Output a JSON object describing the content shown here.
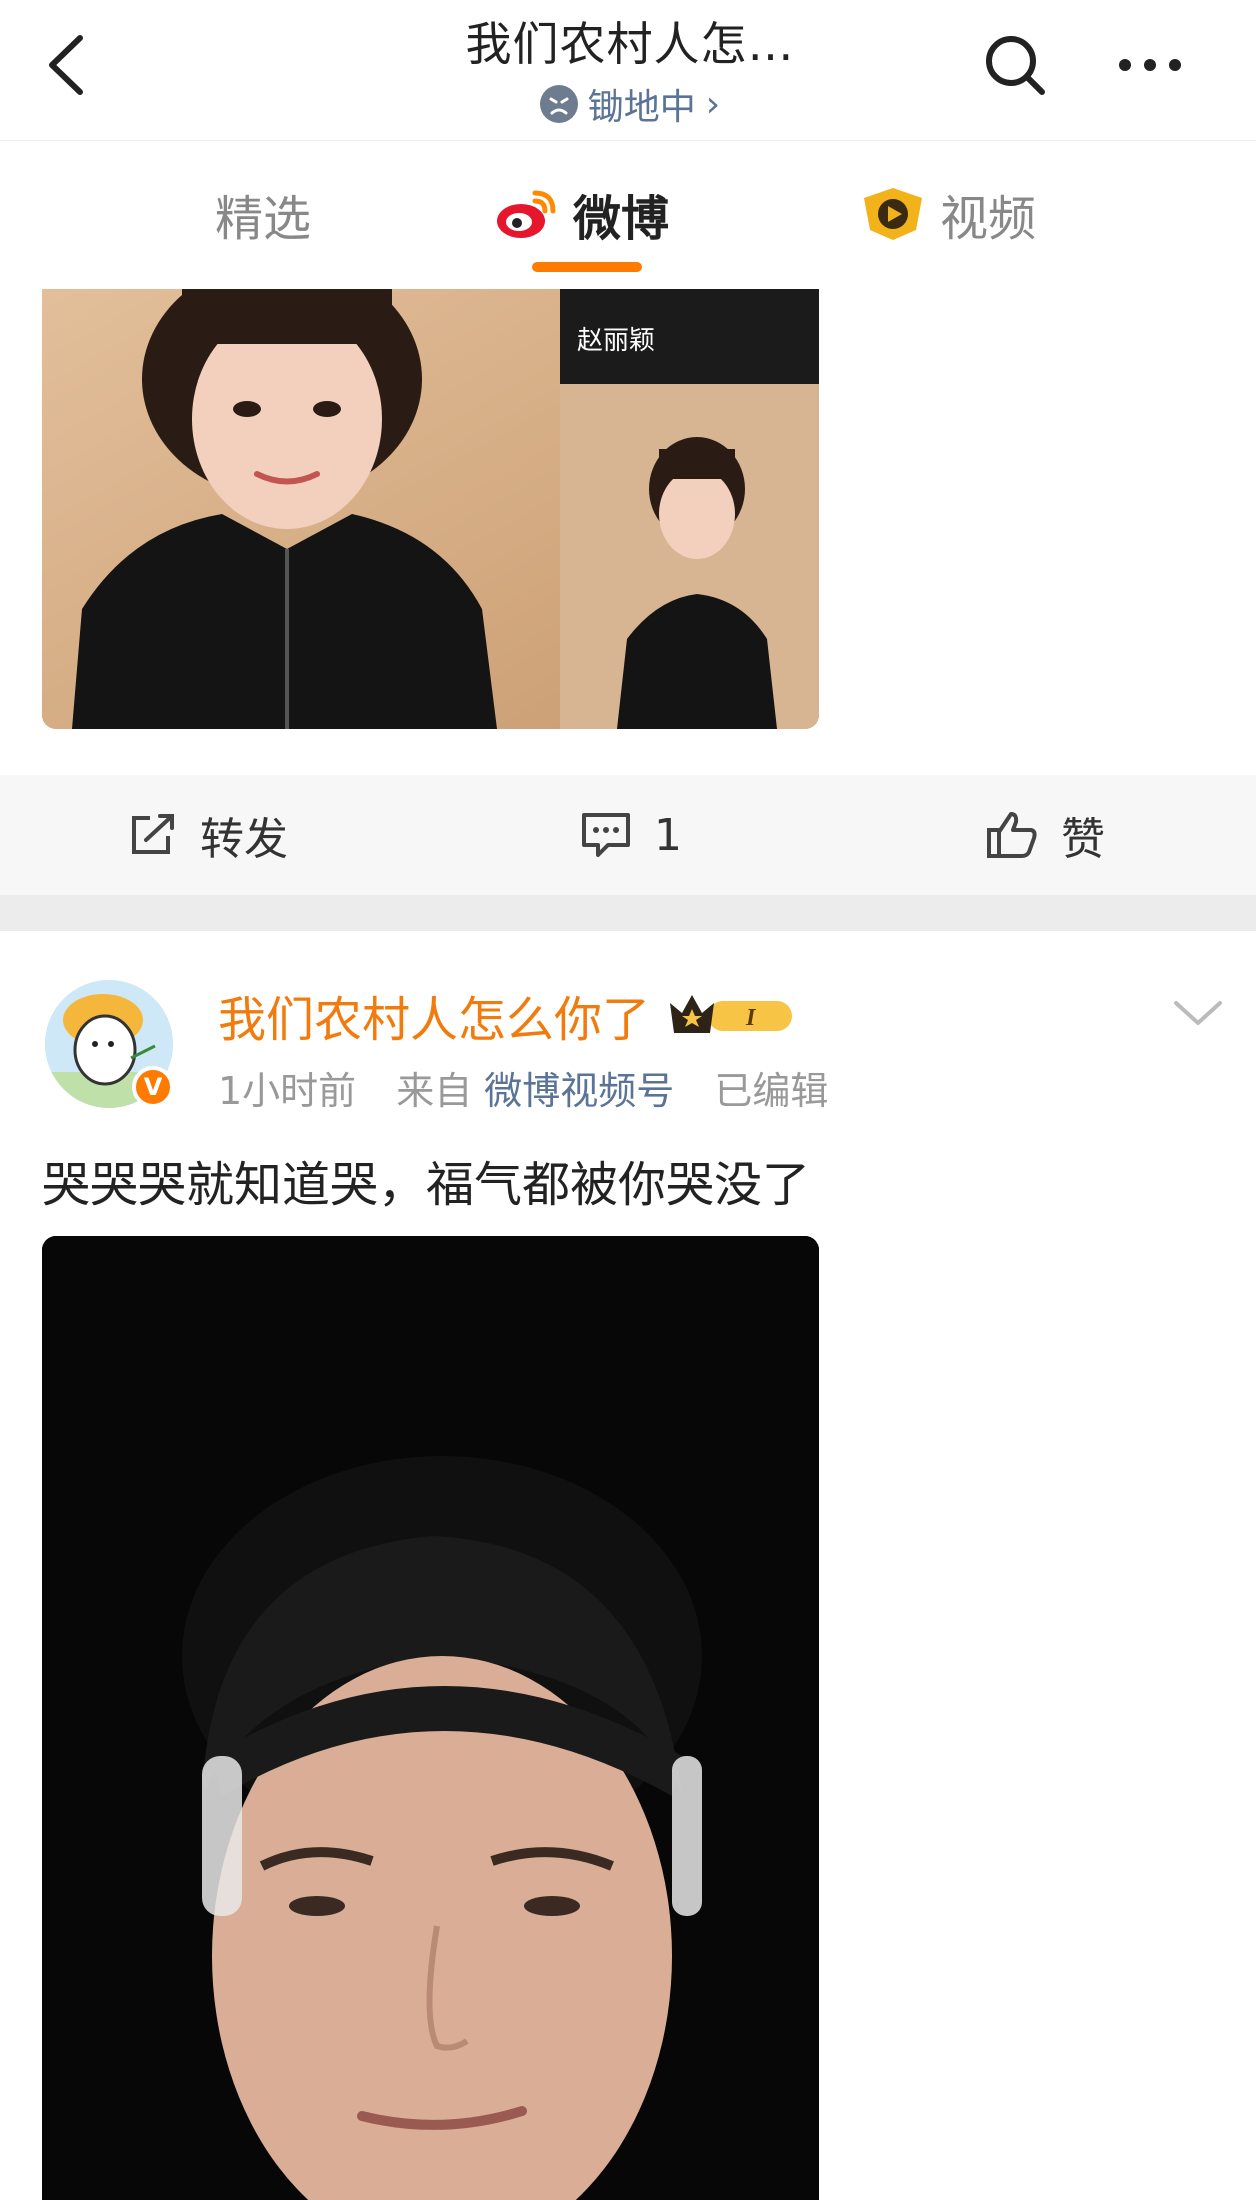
{
  "header": {
    "title": "我们农村人怎…",
    "subtitle": "锄地中",
    "subtitle_arrow": "›",
    "back_icon": "chevron-left-icon",
    "search_icon": "search-icon",
    "more_icon": "more-dots-icon"
  },
  "tabs": [
    {
      "label": "精选",
      "active": false
    },
    {
      "label": "微博",
      "active": true
    },
    {
      "label": "视频",
      "active": false
    }
  ],
  "accent_color": "#ff7a00",
  "post1": {
    "image_caption": "赵丽颖",
    "actions": {
      "repost": "转发",
      "comment_count": "1",
      "like": "赞"
    }
  },
  "post2": {
    "author": "我们农村人怎么你了",
    "time": "1小时前",
    "source_prefix": "来自",
    "source": "微博视频号",
    "edited": "已编辑",
    "text": "哭哭哭就知道哭，福气都被你哭没了",
    "badge_level": "I"
  }
}
